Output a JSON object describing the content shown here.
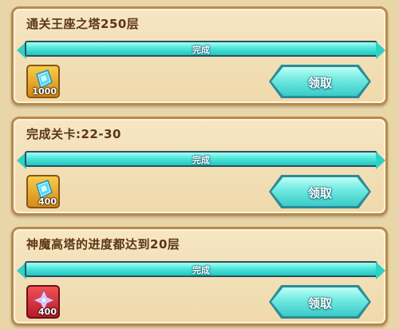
{
  "tasks": [
    {
      "title": "通关王座之塔250层",
      "progress_label": "完成",
      "progress": 1.0,
      "reward": {
        "icon": "blue-crystal-icon",
        "count": "1000",
        "frame": "gold"
      },
      "claim_label": "领取"
    },
    {
      "title": "完成关卡:22-30",
      "progress_label": "完成",
      "progress": 1.0,
      "reward": {
        "icon": "blue-crystal-icon",
        "count": "400",
        "frame": "gold"
      },
      "claim_label": "领取"
    },
    {
      "title": "神魔高塔的进度都达到20层",
      "progress_label": "完成",
      "progress": 1.0,
      "reward": {
        "icon": "pink-crystal-icon",
        "count": "400",
        "frame": "red"
      },
      "claim_label": "领取"
    }
  ],
  "colors": {
    "background": "#e9d6a8",
    "panel_border": "#b88a4a",
    "progress_fill": "#4fe6da",
    "button": "#6ee9e0",
    "title_text": "#5a3516"
  }
}
